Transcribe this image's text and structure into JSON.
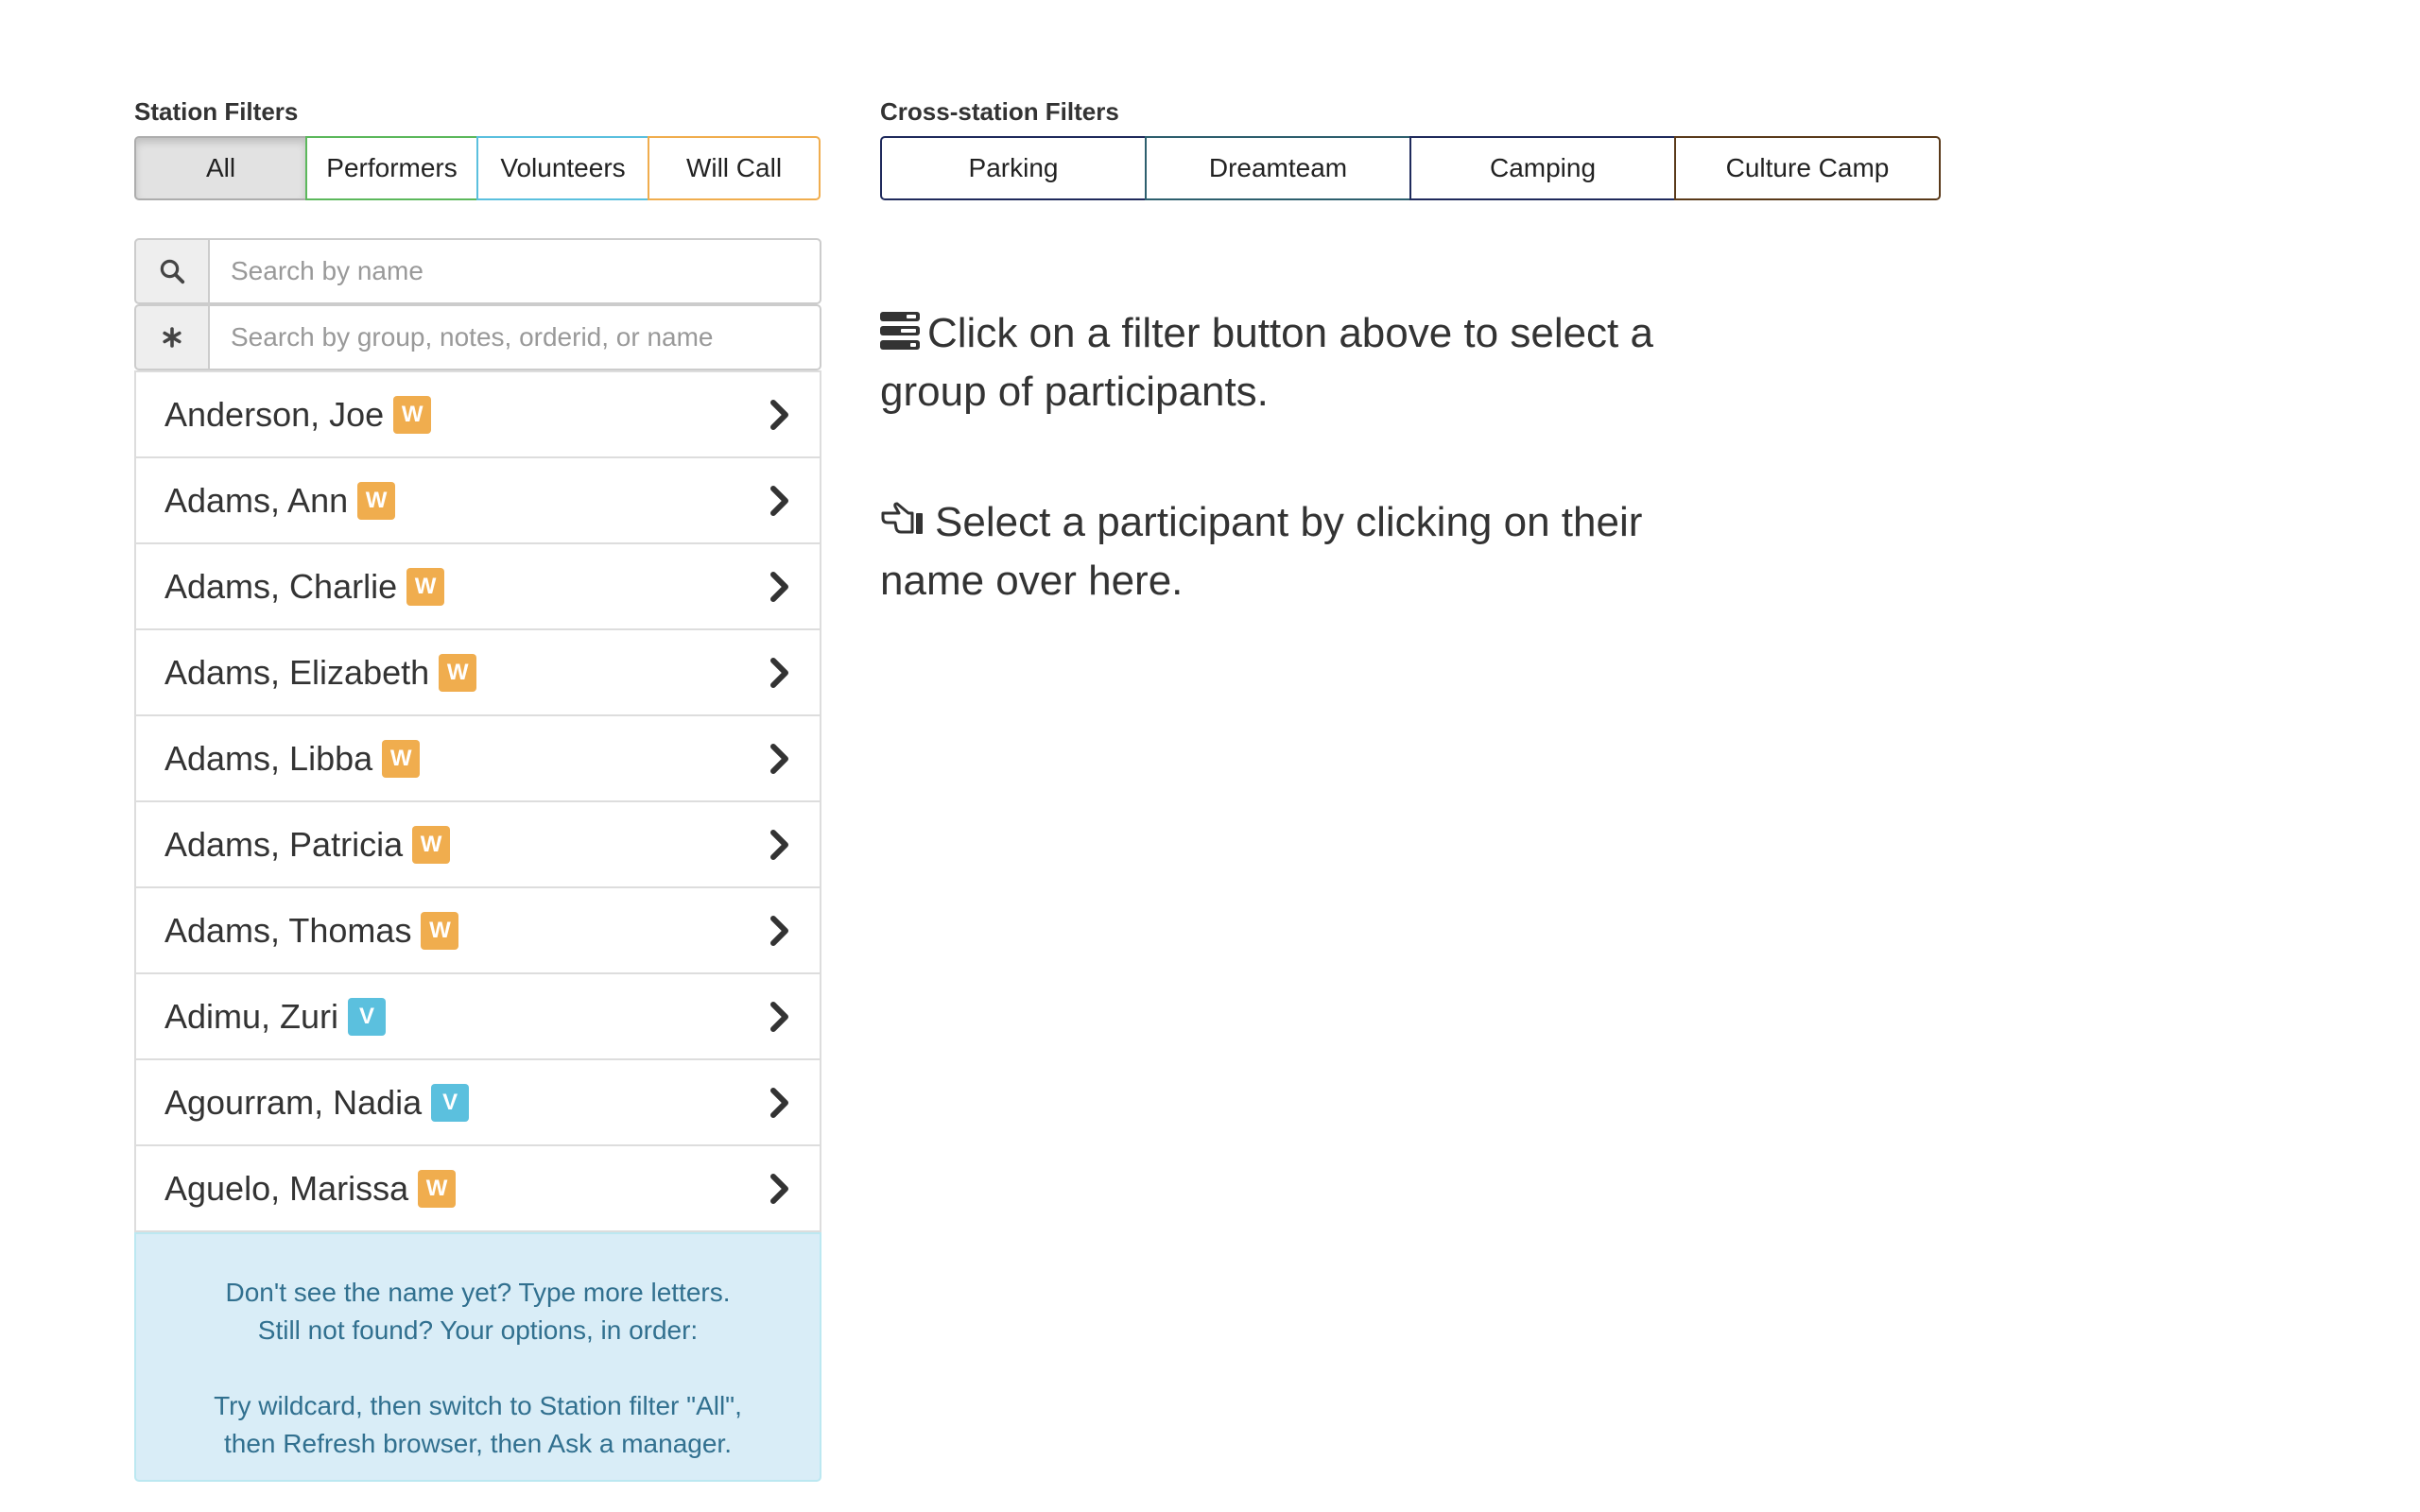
{
  "station_filters": {
    "label": "Station Filters",
    "buttons": [
      "All",
      "Performers",
      "Volunteers",
      "Will Call"
    ]
  },
  "cross_station_filters": {
    "label": "Cross-station Filters",
    "buttons": [
      "Parking",
      "Dreamteam",
      "Camping",
      "Culture Camp"
    ]
  },
  "search": {
    "name_placeholder": "Search by name",
    "wildcard_placeholder": "Search by group, notes, orderid, or name",
    "name_icon": "search-icon",
    "wildcard_icon": "asterisk-icon"
  },
  "participants": [
    {
      "name": "Anderson, Joe",
      "badge": "W"
    },
    {
      "name": "Adams, Ann",
      "badge": "W"
    },
    {
      "name": "Adams, Charlie",
      "badge": "W"
    },
    {
      "name": "Adams, Elizabeth",
      "badge": "W"
    },
    {
      "name": "Adams, Libba",
      "badge": "W"
    },
    {
      "name": "Adams, Patricia",
      "badge": "W"
    },
    {
      "name": "Adams, Thomas",
      "badge": "W"
    },
    {
      "name": "Adimu, Zuri",
      "badge": "V"
    },
    {
      "name": "Agourram, Nadia",
      "badge": "V"
    },
    {
      "name": "Aguelo, Marissa",
      "badge": "W"
    }
  ],
  "help": {
    "line1": "Don't see the name yet? Type more letters.",
    "line2": "Still not found? Your options, in order:",
    "line3": "Try wildcard, then switch to Station filter \"All\",",
    "line4": "then Refresh browser, then Ask a manager."
  },
  "hints": {
    "filter_hint": "Click on a filter button above to select a group of participants.",
    "participant_hint": "Select a participant by clicking on their name over here."
  },
  "colors": {
    "performers": "#5cb85c",
    "volunteers": "#5bc0de",
    "will_call": "#f0ad4e",
    "badge_w": "#f0ad4e",
    "badge_v": "#5bc0de",
    "help_bg": "#d9edf7",
    "help_text": "#31708f"
  }
}
